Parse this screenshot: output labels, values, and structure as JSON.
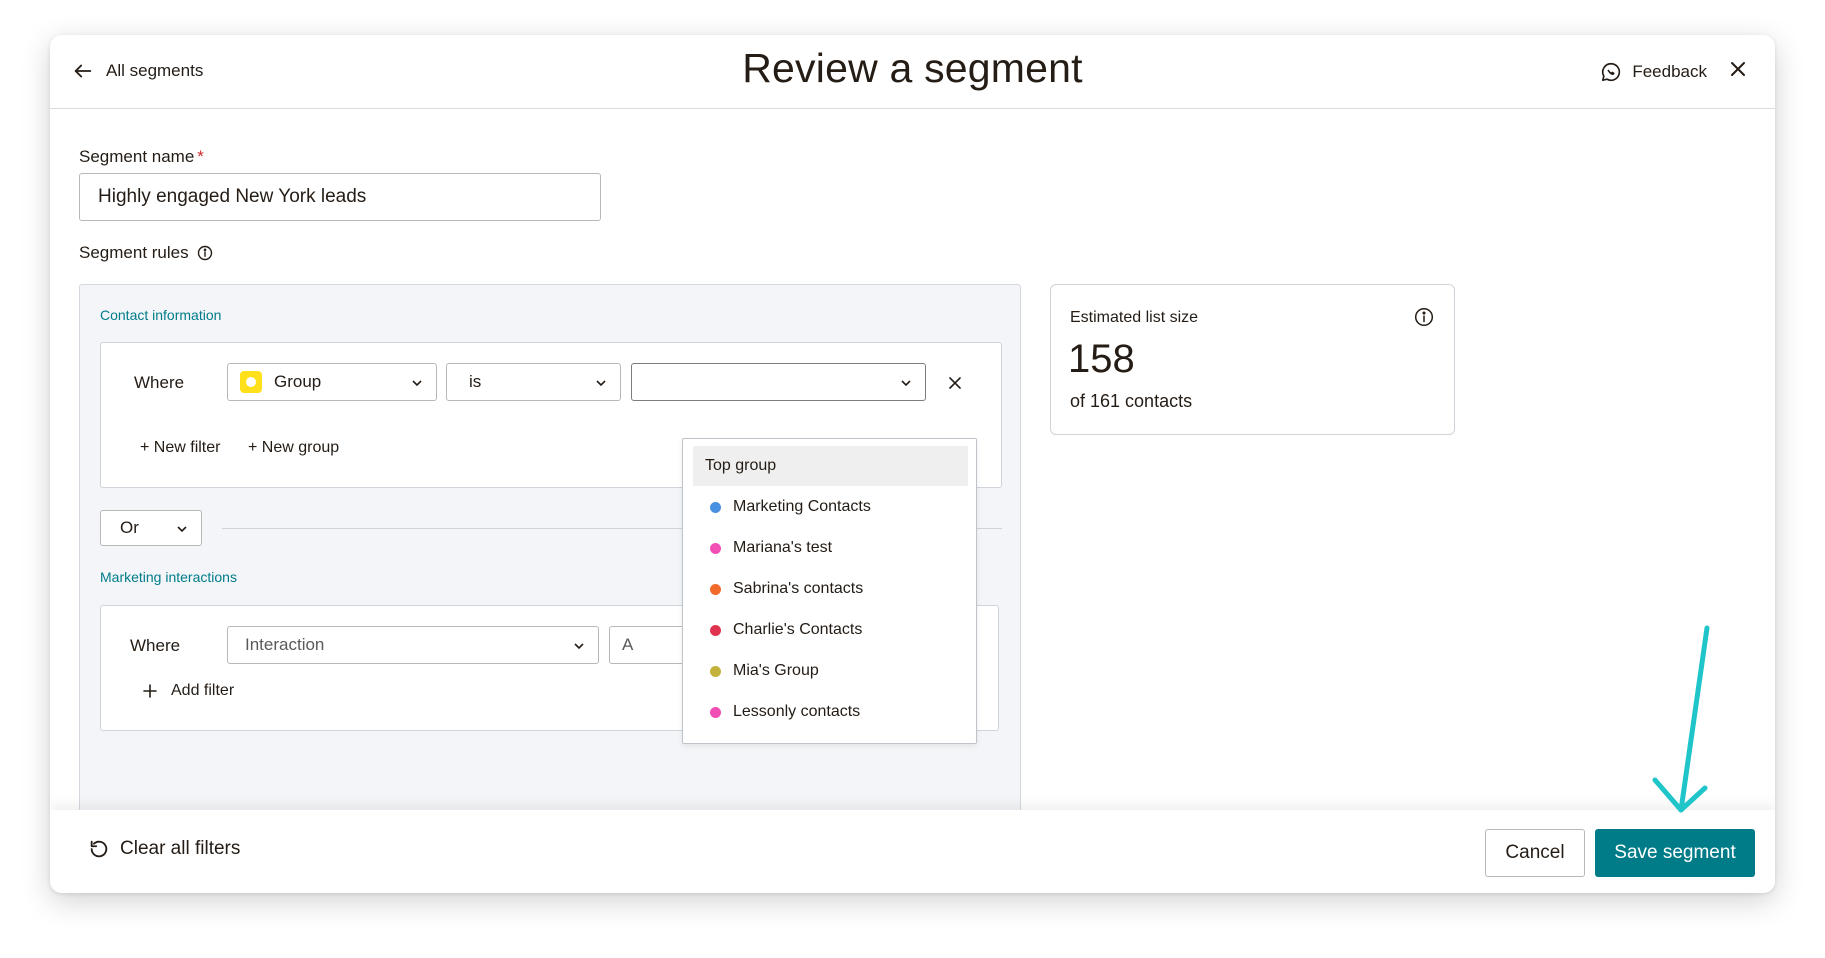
{
  "header": {
    "back_label": "All segments",
    "title": "Review a segment",
    "feedback_label": "Feedback"
  },
  "form": {
    "segment_name_label": "Segment name",
    "required_mark": "*",
    "segment_name_value": "Highly engaged New York leads",
    "segment_rules_label": "Segment rules"
  },
  "contact_section": {
    "title": "Contact information",
    "where_label": "Where",
    "field_select": "Group",
    "operator_select": "is",
    "value_select": "",
    "new_filter": "+ New filter",
    "new_group": "+ New group"
  },
  "logic_select": "Or",
  "marketing_section": {
    "title": "Marketing interactions",
    "where_label": "Where",
    "field_select": "Interaction",
    "operator_select_visible": "A",
    "add_filter": "Add filter"
  },
  "dropdown": {
    "items": [
      {
        "label": "Top group",
        "color": ""
      },
      {
        "label": "Marketing Contacts",
        "color": "#4a90e2"
      },
      {
        "label": "Mariana's test",
        "color": "#f24fb5"
      },
      {
        "label": "Sabrina's contacts",
        "color": "#f26b2b"
      },
      {
        "label": "Charlie's Contacts",
        "color": "#e0334f"
      },
      {
        "label": "Mia's Group",
        "color": "#c4b23c"
      },
      {
        "label": "Lessonly contacts",
        "color": "#f24fb5"
      }
    ]
  },
  "estimate": {
    "label": "Estimated list size",
    "value": "158",
    "subtext": "of 161 contacts"
  },
  "footer": {
    "clear_label": "Clear all filters",
    "cancel_label": "Cancel",
    "save_label": "Save segment"
  },
  "colors": {
    "accent": "#007c89",
    "annotation_arrow": "#1fc5c9",
    "group_icon": "#ffe01b"
  }
}
